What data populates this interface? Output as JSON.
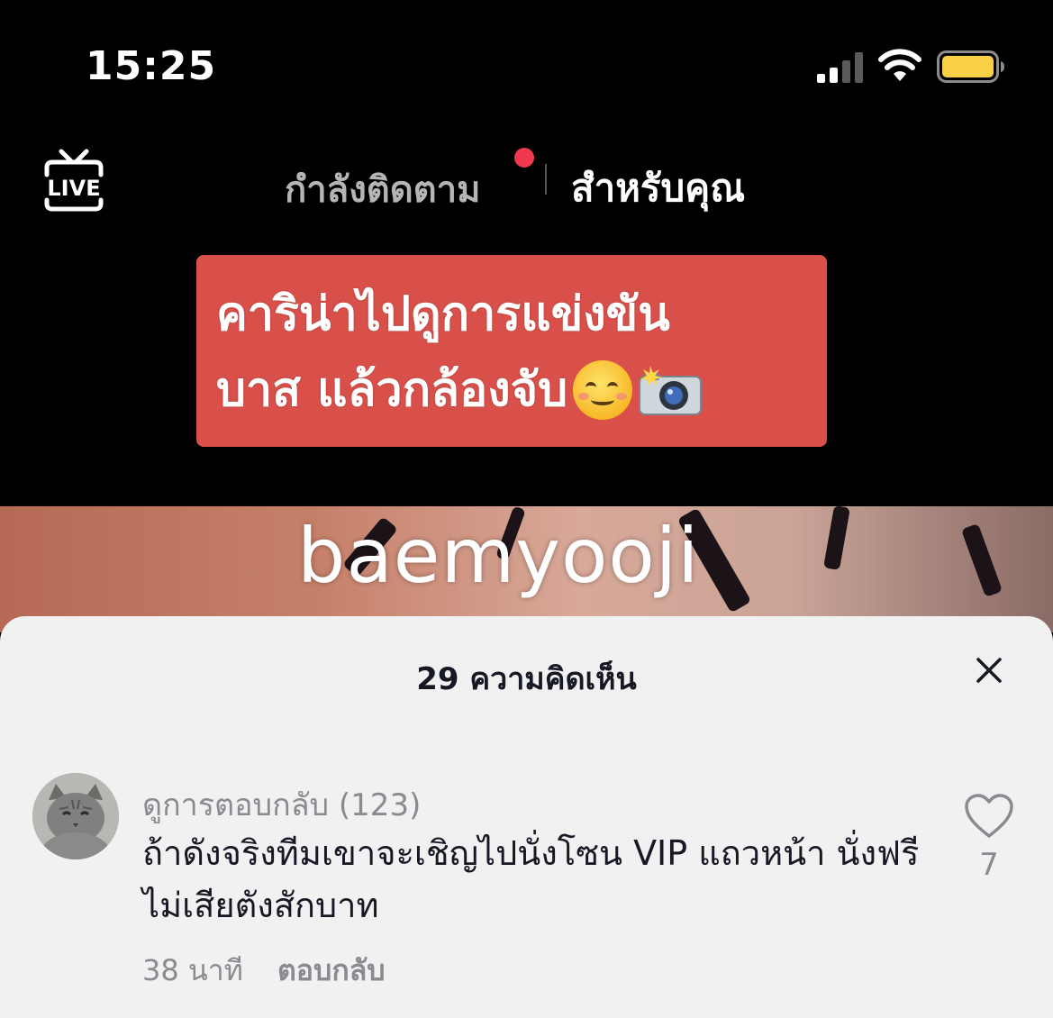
{
  "status_bar": {
    "time": "15:25",
    "icons": [
      "signal-icon",
      "wifi-icon",
      "battery-icon"
    ],
    "battery_color": "#f7d046"
  },
  "top_nav": {
    "live_label": "LIVE",
    "tab_following": "กำลังติดตาม",
    "tab_for_you": "สำหรับคุณ",
    "notification_dot_color": "#f0384e"
  },
  "video": {
    "caption_line1": "คาริน่าไปดูการแข่งขัน",
    "caption_line2": "บาส แล้วกล้องจับ",
    "caption_bg": "#d9504a",
    "caption_emojis": [
      "smiling-face-emoji",
      "camera-flash-emoji"
    ],
    "watermark": "baemyooji"
  },
  "comments_sheet": {
    "title": "29 ความคิดเห็น",
    "comment": {
      "author": "ดูการตอบกลับ (123)",
      "text": "ถ้าดังจริงทีมเขาจะเชิญไปนั่งโซน VIP แถวหน้า นั่งฟรีไม่เสียตังสักบาท",
      "time": "38 นาที",
      "reply_label": "ตอบกลับ",
      "likes": "7"
    }
  }
}
